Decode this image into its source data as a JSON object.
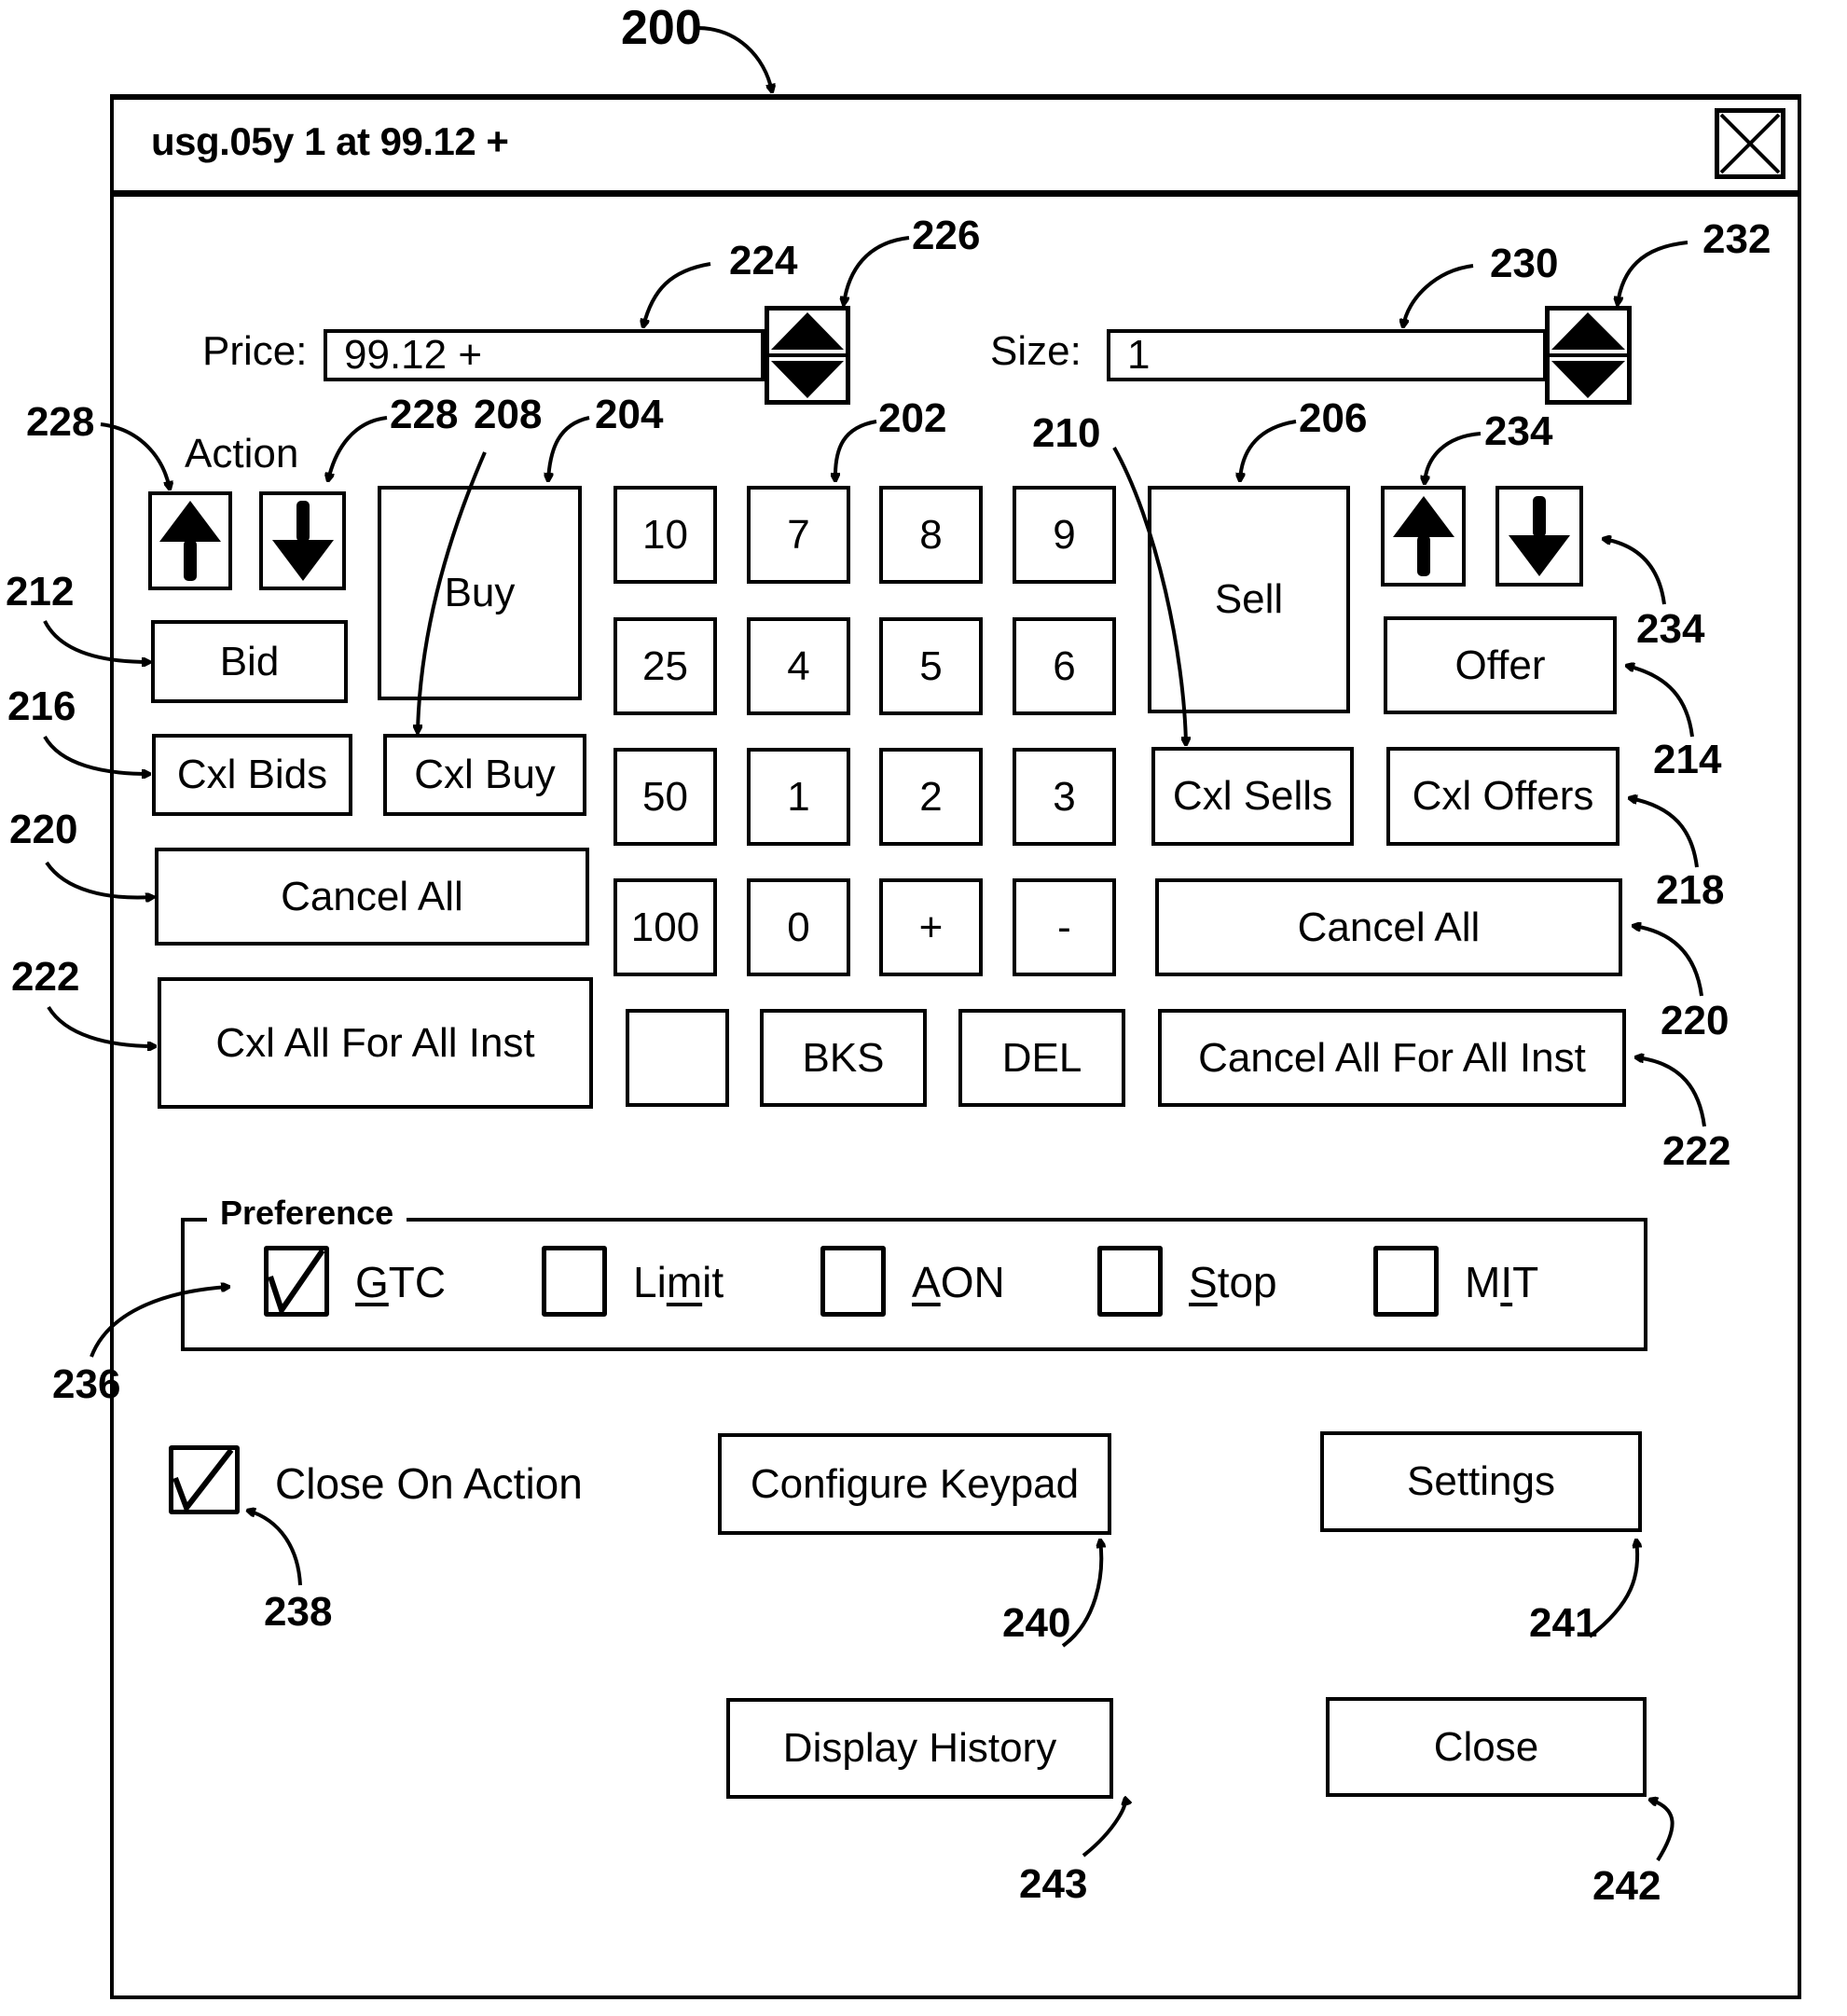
{
  "figure_ref": "200",
  "window": {
    "title": "usg.05y 1 at 99.12 +",
    "close_icon": "close-x-box-icon"
  },
  "price": {
    "label": "Price:",
    "value": "99.12 +"
  },
  "size": {
    "label": "Size:",
    "value": "1"
  },
  "action_label": "Action",
  "buy_side": {
    "price_up_icon": "arrow-up-icon",
    "price_down_icon": "arrow-down-icon",
    "buy": "Buy",
    "bid": "Bid",
    "cxl_bids": "Cxl Bids",
    "cxl_buy": "Cxl Buy",
    "cancel_all": "Cancel All",
    "cxl_all_for_all_inst": "Cxl All For All Inst"
  },
  "keypad": {
    "rows": [
      [
        "10",
        "7",
        "8",
        "9"
      ],
      [
        "25",
        "4",
        "5",
        "6"
      ],
      [
        "50",
        "1",
        "2",
        "3"
      ],
      [
        "100",
        "0",
        "+",
        "-"
      ]
    ],
    "last_row": [
      "",
      "BKS",
      "DEL"
    ]
  },
  "sell_side": {
    "sell": "Sell",
    "offer": "Offer",
    "cxl_sells": "Cxl Sells",
    "cxl_offers": "Cxl Offers",
    "cancel_all": "Cancel All",
    "cancel_all_for_all_inst": "Cancel All For All Inst",
    "price_up_icon": "arrow-up-icon",
    "price_down_icon": "arrow-down-icon"
  },
  "preference": {
    "label": "Preference",
    "options": [
      {
        "pre": "",
        "mn": "G",
        "post": "TC",
        "checked": true
      },
      {
        "pre": "Li",
        "mn": "m",
        "post": "it",
        "checked": false
      },
      {
        "pre": "",
        "mn": "A",
        "post": "ON",
        "checked": false
      },
      {
        "pre": "",
        "mn": "S",
        "post": "top",
        "checked": false
      },
      {
        "pre": "M",
        "mn": "I",
        "post": "T",
        "checked": false
      }
    ]
  },
  "close_on_action": {
    "label": "Close On Action",
    "checked": true
  },
  "buttons": {
    "configure_keypad": "Configure Keypad",
    "settings": "Settings",
    "display_history": "Display History",
    "close": "Close"
  },
  "callouts": {
    "c200": "200",
    "c224": "224",
    "c226": "226",
    "c230": "230",
    "c232": "232",
    "c228a": "228",
    "c228b": "228",
    "c208": "208",
    "c204": "204",
    "c202": "202",
    "c210": "210",
    "c206": "206",
    "c234a": "234",
    "c234b": "234",
    "c212": "212",
    "c216": "216",
    "c220a": "220",
    "c222a": "222",
    "c214": "214",
    "c218": "218",
    "c220b": "220",
    "c222b": "222",
    "c236": "236",
    "c238": "238",
    "c240": "240",
    "c241": "241",
    "c243": "243",
    "c242": "242"
  }
}
